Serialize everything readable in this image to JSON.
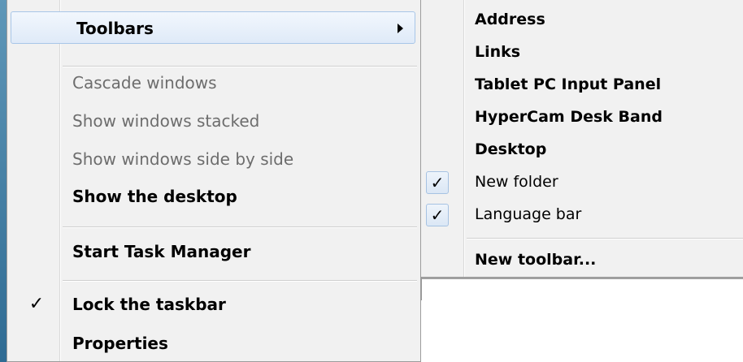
{
  "context_menu": {
    "items": [
      {
        "label": "Toolbars",
        "state": "highlighted",
        "has_submenu": true
      },
      {
        "label": "Cascade windows",
        "state": "disabled"
      },
      {
        "label": "Show windows stacked",
        "state": "disabled"
      },
      {
        "label": "Show windows side by side",
        "state": "disabled"
      },
      {
        "label": "Show the desktop",
        "state": "enabled"
      },
      {
        "label": "Start Task Manager",
        "state": "enabled"
      },
      {
        "label": "Lock the taskbar",
        "state": "checked"
      },
      {
        "label": "Properties",
        "state": "enabled"
      }
    ]
  },
  "toolbars_submenu": {
    "items": [
      {
        "label": "Address",
        "checked": false
      },
      {
        "label": "Links",
        "checked": false
      },
      {
        "label": "Tablet PC Input Panel",
        "checked": false
      },
      {
        "label": "HyperCam Desk Band",
        "checked": false
      },
      {
        "label": "Desktop",
        "checked": false
      },
      {
        "label": "New folder",
        "checked": true
      },
      {
        "label": "Language bar",
        "checked": true
      },
      {
        "label": "New toolbar...",
        "checked": false
      }
    ]
  },
  "icons": {
    "checkmark": "✓",
    "submenu_arrow": "chevron-right-icon"
  },
  "colors": {
    "menu_background": "#f1f1f1",
    "highlight_fill": "#dfeaf8",
    "highlight_border": "#a8c6e8",
    "disabled_text": "#6d6d6d",
    "taskbar_edge": "#2f6b93"
  }
}
